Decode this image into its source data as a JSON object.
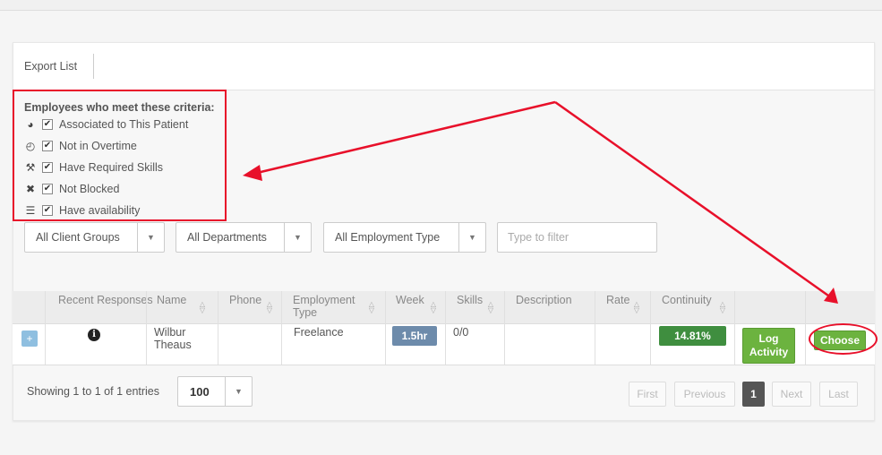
{
  "toolbar": {
    "export_label": "Export List"
  },
  "criteria": {
    "title": "Employees who meet these criteria:",
    "items": [
      {
        "icon": "globe-icon",
        "glyph": "◕",
        "label": "Associated to This Patient"
      },
      {
        "icon": "clock-icon",
        "glyph": "◴",
        "label": "Not in Overtime"
      },
      {
        "icon": "wrench-icon",
        "glyph": "⚒",
        "label": "Have Required Skills"
      },
      {
        "icon": "blocked-icon",
        "glyph": "✖",
        "label": "Not Blocked"
      },
      {
        "icon": "list-icon",
        "glyph": "☰",
        "label": "Have availability"
      }
    ],
    "check_glyph": "✔"
  },
  "filters": {
    "client_groups": "All Client Groups",
    "departments": "All Departments",
    "employment_type": "All Employment Type",
    "search_placeholder": "Type to filter",
    "caret": "▼"
  },
  "table": {
    "headers": {
      "recent_responses": "Recent Responses",
      "name": "Name",
      "phone": "Phone",
      "employment_type": "Employment Type",
      "week": "Week",
      "skills": "Skills",
      "description": "Description",
      "rate": "Rate",
      "continuity": "Continuity"
    },
    "row": {
      "expand": "+",
      "info_glyph": "i",
      "name": "Wilbur Theaus",
      "phone": "",
      "employment_type": "Freelance",
      "week": "1.5hr",
      "skills": "0/0",
      "description": "",
      "rate": "",
      "continuity": "14.81%",
      "log_activity": "Log Activity",
      "choose": "Choose"
    }
  },
  "footer": {
    "showing": "Showing 1 to 1 of 1 entries",
    "page_length": "100",
    "pagination": {
      "first": "First",
      "previous": "Previous",
      "current": "1",
      "next": "Next",
      "last": "Last"
    }
  },
  "colors": {
    "highlight": "#e8102a",
    "success": "#6cb33f",
    "continuity": "#3f8e3f",
    "week_badge": "#6d8bab"
  }
}
